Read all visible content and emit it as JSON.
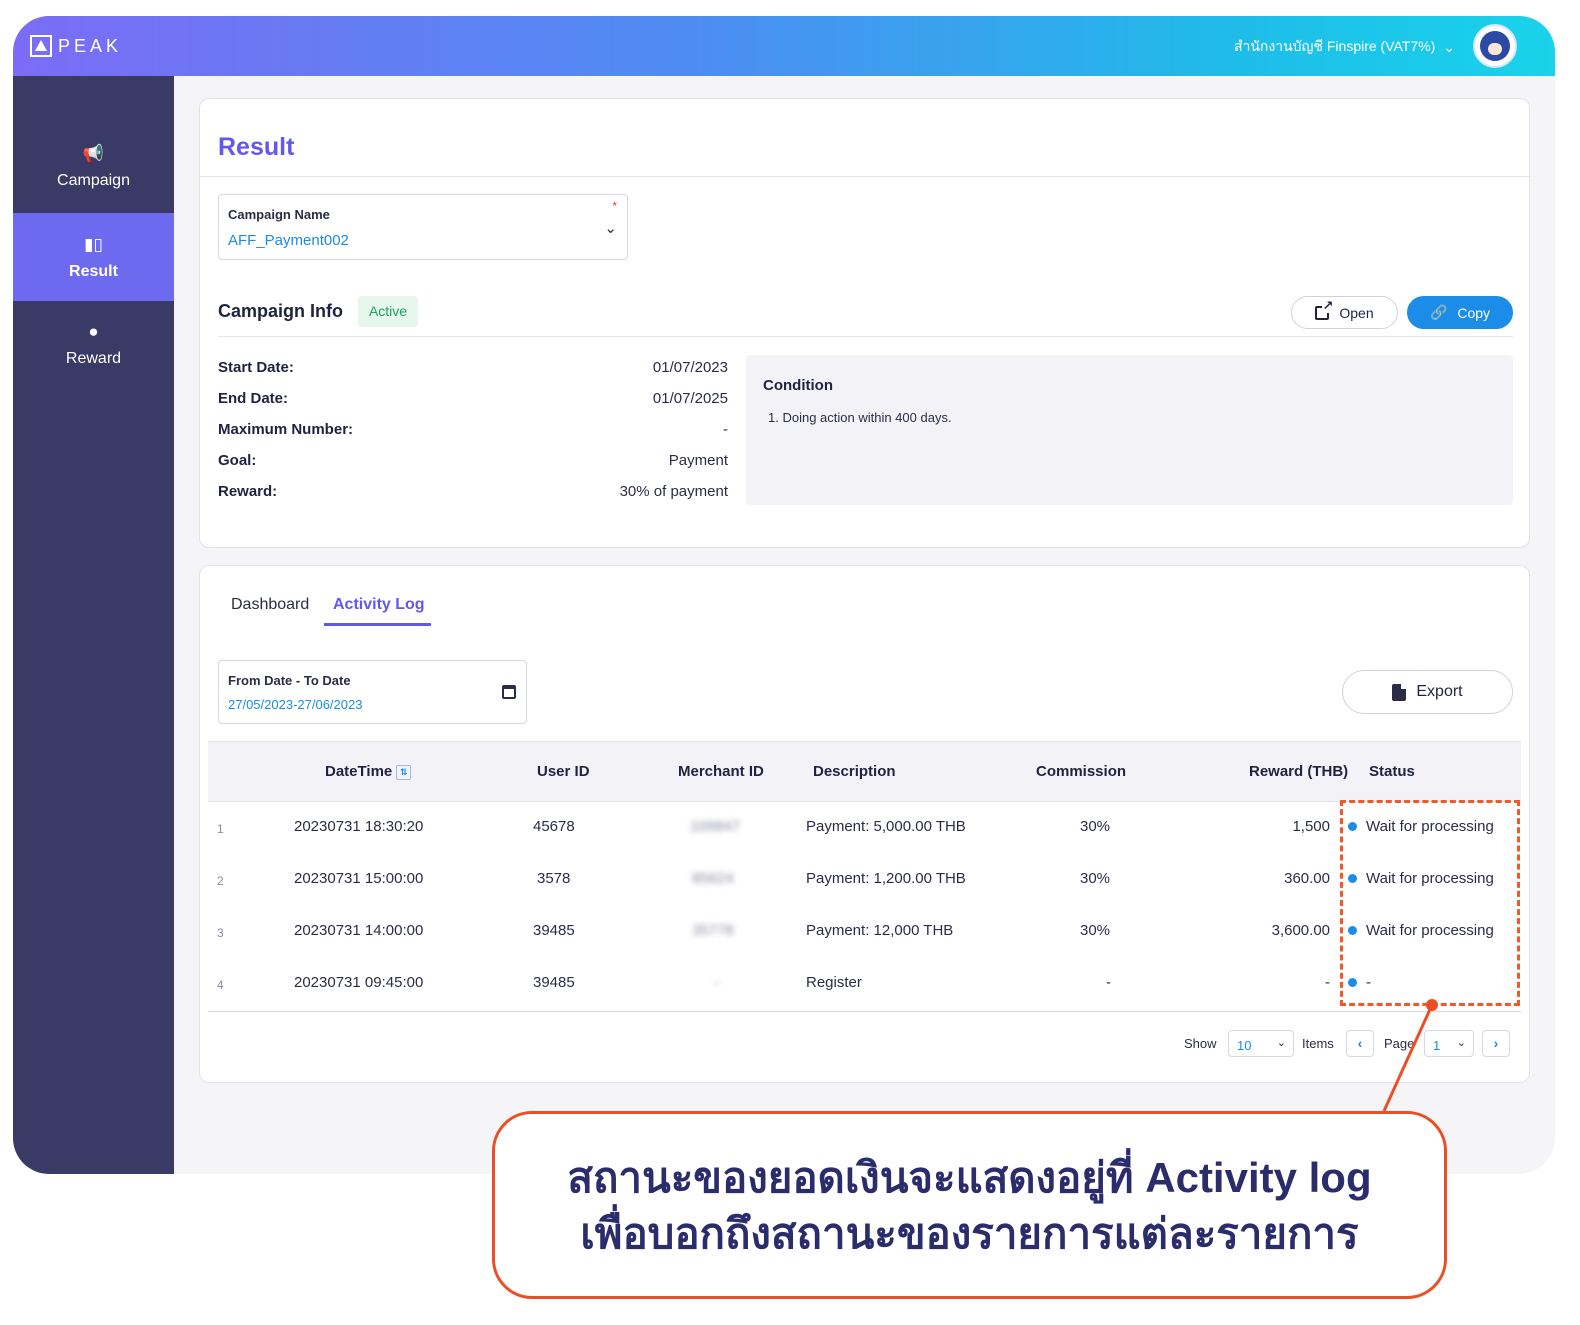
{
  "header": {
    "brand": "PEAK",
    "organization": "สำนักงานบัญชี Finspire (VAT7%)",
    "icons": [
      "peak-logo",
      "chevron-down-icon",
      "avatar"
    ]
  },
  "sidebar": {
    "items": [
      {
        "label": "Campaign",
        "icon": "megaphone-icon",
        "active": false
      },
      {
        "label": "Result",
        "icon": "bar-chart-icon",
        "active": true
      },
      {
        "label": "Reward",
        "icon": "piggy-bank-icon",
        "active": false
      }
    ]
  },
  "result": {
    "title": "Result",
    "campaign_select": {
      "label": "Campaign Name",
      "required_mark": "*",
      "value": "AFF_Payment002"
    },
    "info_title": "Campaign Info",
    "status_badge": "Active",
    "open_label": "Open",
    "copy_label": "Copy",
    "details": [
      {
        "key": "Start Date:",
        "value": "01/07/2023"
      },
      {
        "key": "End Date:",
        "value": "01/07/2025"
      },
      {
        "key": "Maximum Number:",
        "value": "-"
      },
      {
        "key": "Goal:",
        "value": "Payment"
      },
      {
        "key": "Reward:",
        "value": "30% of payment"
      }
    ],
    "condition": {
      "title": "Condition",
      "items": [
        "1. Doing action within 400 days."
      ]
    }
  },
  "activity": {
    "tabs": [
      "Dashboard",
      "Activity Log"
    ],
    "active_tab": "Activity Log",
    "date_filter": {
      "label": "From Date - To Date",
      "value": "27/05/2023-27/06/2023"
    },
    "export_label": "Export",
    "columns": [
      "DateTime",
      "User ID",
      "Merchant ID",
      "Description",
      "Commission",
      "Reward (THB)",
      "Status"
    ],
    "rows": [
      {
        "no": "1",
        "datetime": "20230731 18:30:20",
        "user_id": "45678",
        "merchant_id": "109847",
        "description": "Payment: 5,000.00 THB",
        "commission": "30%",
        "reward": "1,500",
        "status": "Wait for processing"
      },
      {
        "no": "2",
        "datetime": "20230731 15:00:00",
        "user_id": "3578",
        "merchant_id": "85624",
        "description": "Payment: 1,200.00 THB",
        "commission": "30%",
        "reward": "360.00",
        "status": "Wait for processing"
      },
      {
        "no": "3",
        "datetime": "20230731 14:00:00",
        "user_id": "39485",
        "merchant_id": "35778",
        "description": "Payment: 12,000 THB",
        "commission": "30%",
        "reward": "3,600.00",
        "status": "Wait for processing"
      },
      {
        "no": "4",
        "datetime": "20230731 09:45:00",
        "user_id": "39485",
        "merchant_id": "-",
        "description": "Register",
        "commission": "-",
        "reward": "-",
        "status": "-"
      }
    ],
    "pagination": {
      "show_label": "Show",
      "page_size": "10",
      "items_label": "Items",
      "page_label": "Page",
      "page": "1"
    }
  },
  "callout": {
    "line1": "สถานะของยอดเงินจะแสดงอยู่ที่ Activity log",
    "line2": "เพื่อบอกถึงสถานะของรายการแต่ละรายการ",
    "accent_color": "#ea4f25"
  },
  "colors": {
    "primary": "#6457ee",
    "link": "#1b8ce8",
    "sidebar": "#3a3a66",
    "sidebar_active": "#6d6af0",
    "success": "#1aa262"
  }
}
